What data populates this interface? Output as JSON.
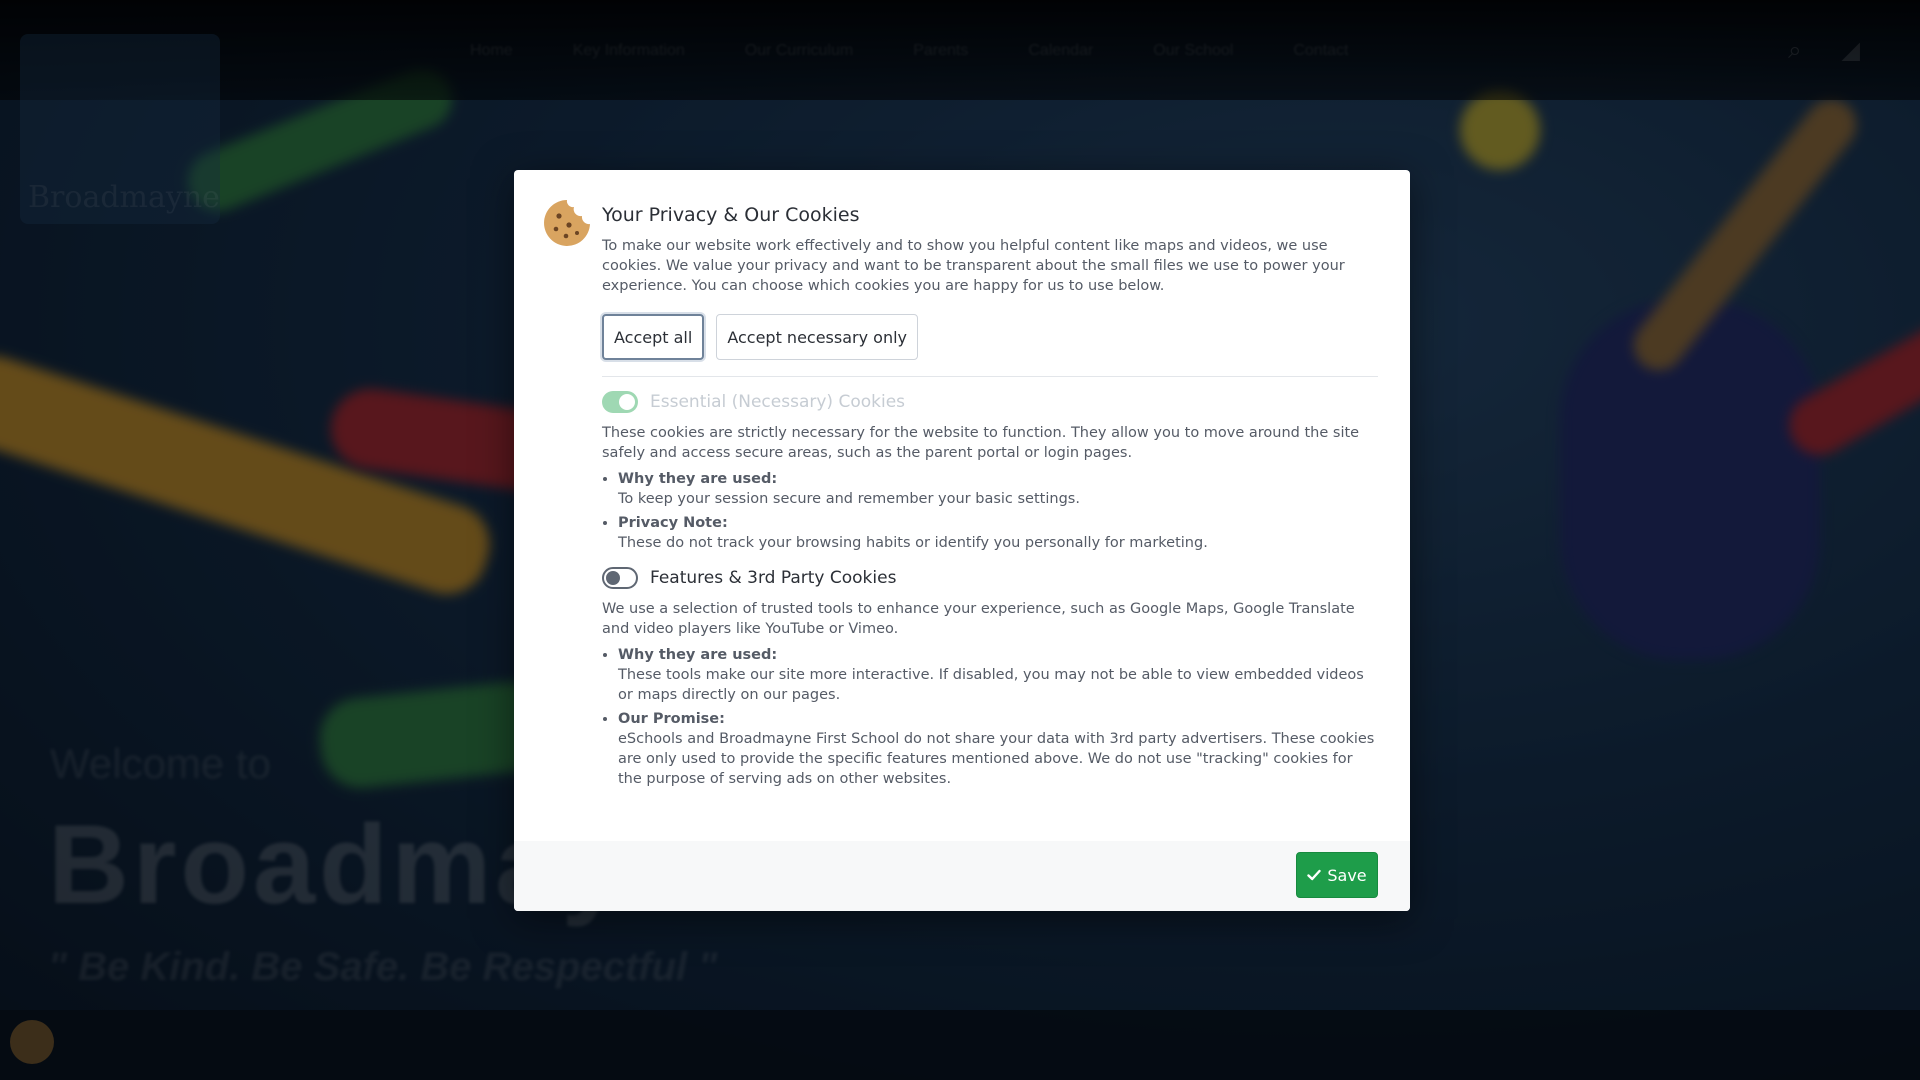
{
  "background": {
    "nav_items": [
      "Home",
      "Key Information",
      "Our Curriculum",
      "Parents",
      "Calendar",
      "Our School",
      "Contact"
    ],
    "logo_text": "Broadmayne",
    "welcome": "Welcome to",
    "school_name": "Broadmayne",
    "motto": "\" Be Kind. Be Safe. Be Respectful \""
  },
  "modal": {
    "title": "Your Privacy & Our Cookies",
    "intro": "To make our website work effectively and to show you helpful content like maps and videos, we use cookies. We value your privacy and want to be transparent about the small files we use to power your experience. You can choose which cookies you are happy for us to use below.",
    "accept_all_label": "Accept all",
    "accept_necessary_label": "Accept necessary only",
    "essential": {
      "label": "Essential (Necessary) Cookies",
      "enabled": true,
      "description": "These cookies are strictly necessary for the website to function. They allow you to move around the site safely and access secure areas, such as the parent portal or login pages.",
      "points": [
        {
          "title": "Why they are used:",
          "text": "To keep your session secure and remember your basic settings."
        },
        {
          "title": "Privacy Note:",
          "text": "These do not track your browsing habits or identify you personally for marketing."
        }
      ]
    },
    "features": {
      "label": "Features & 3rd Party Cookies",
      "enabled": false,
      "description": "We use a selection of trusted tools to enhance your experience, such as Google Maps, Google Translate and video players like YouTube or Vimeo.",
      "points": [
        {
          "title": "Why they are used:",
          "text": "These tools make our site more interactive. If disabled, you may not be able to view embedded videos or maps directly on our pages."
        },
        {
          "title": "Our Promise:",
          "text": "eSchools and Broadmayne First School do not share your data with 3rd party advertisers. These cookies are only used to provide the specific features mentioned above. We do not use \"tracking\" cookies for the purpose of serving ads on other websites."
        }
      ]
    },
    "save_label": "Save"
  },
  "colors": {
    "save_button": "#1e9d4a",
    "toggle_on": "#9fd8b3",
    "cookie": "#d9a460"
  },
  "icons": [
    "cookie-icon",
    "check-icon",
    "search-icon",
    "translate-icon"
  ]
}
